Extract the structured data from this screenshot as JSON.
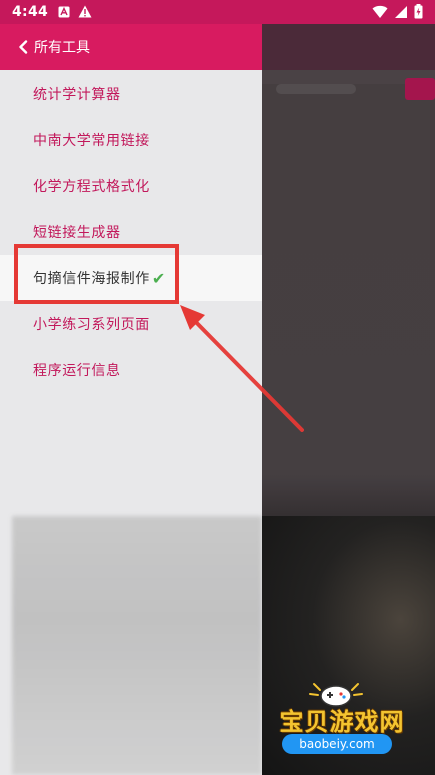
{
  "status_bar": {
    "time": "4:44",
    "icons": [
      "a-box-icon",
      "warning-icon",
      "wifi-icon",
      "signal-icon",
      "battery-charging-icon"
    ]
  },
  "drawer": {
    "title": "所有工具",
    "back_icon": "chevron-left-icon",
    "items": [
      {
        "label": "统计学计算器",
        "selected": false
      },
      {
        "label": "中南大学常用链接",
        "selected": false
      },
      {
        "label": "化学方程式格式化",
        "selected": false
      },
      {
        "label": "短链接生成器",
        "selected": false
      },
      {
        "label": "句摘信件海报制作",
        "selected": true,
        "check": "✔"
      },
      {
        "label": "小学练习系列页面",
        "selected": false
      },
      {
        "label": "程序运行信息",
        "selected": false
      }
    ]
  },
  "colors": {
    "status_bar": "#c5185b",
    "header": "#d81b60",
    "item_text": "#c2185b",
    "highlight_box": "#e53935",
    "check": "#4caf50"
  },
  "watermark": {
    "title": "宝贝游戏网",
    "url": "baobeiy.com"
  }
}
